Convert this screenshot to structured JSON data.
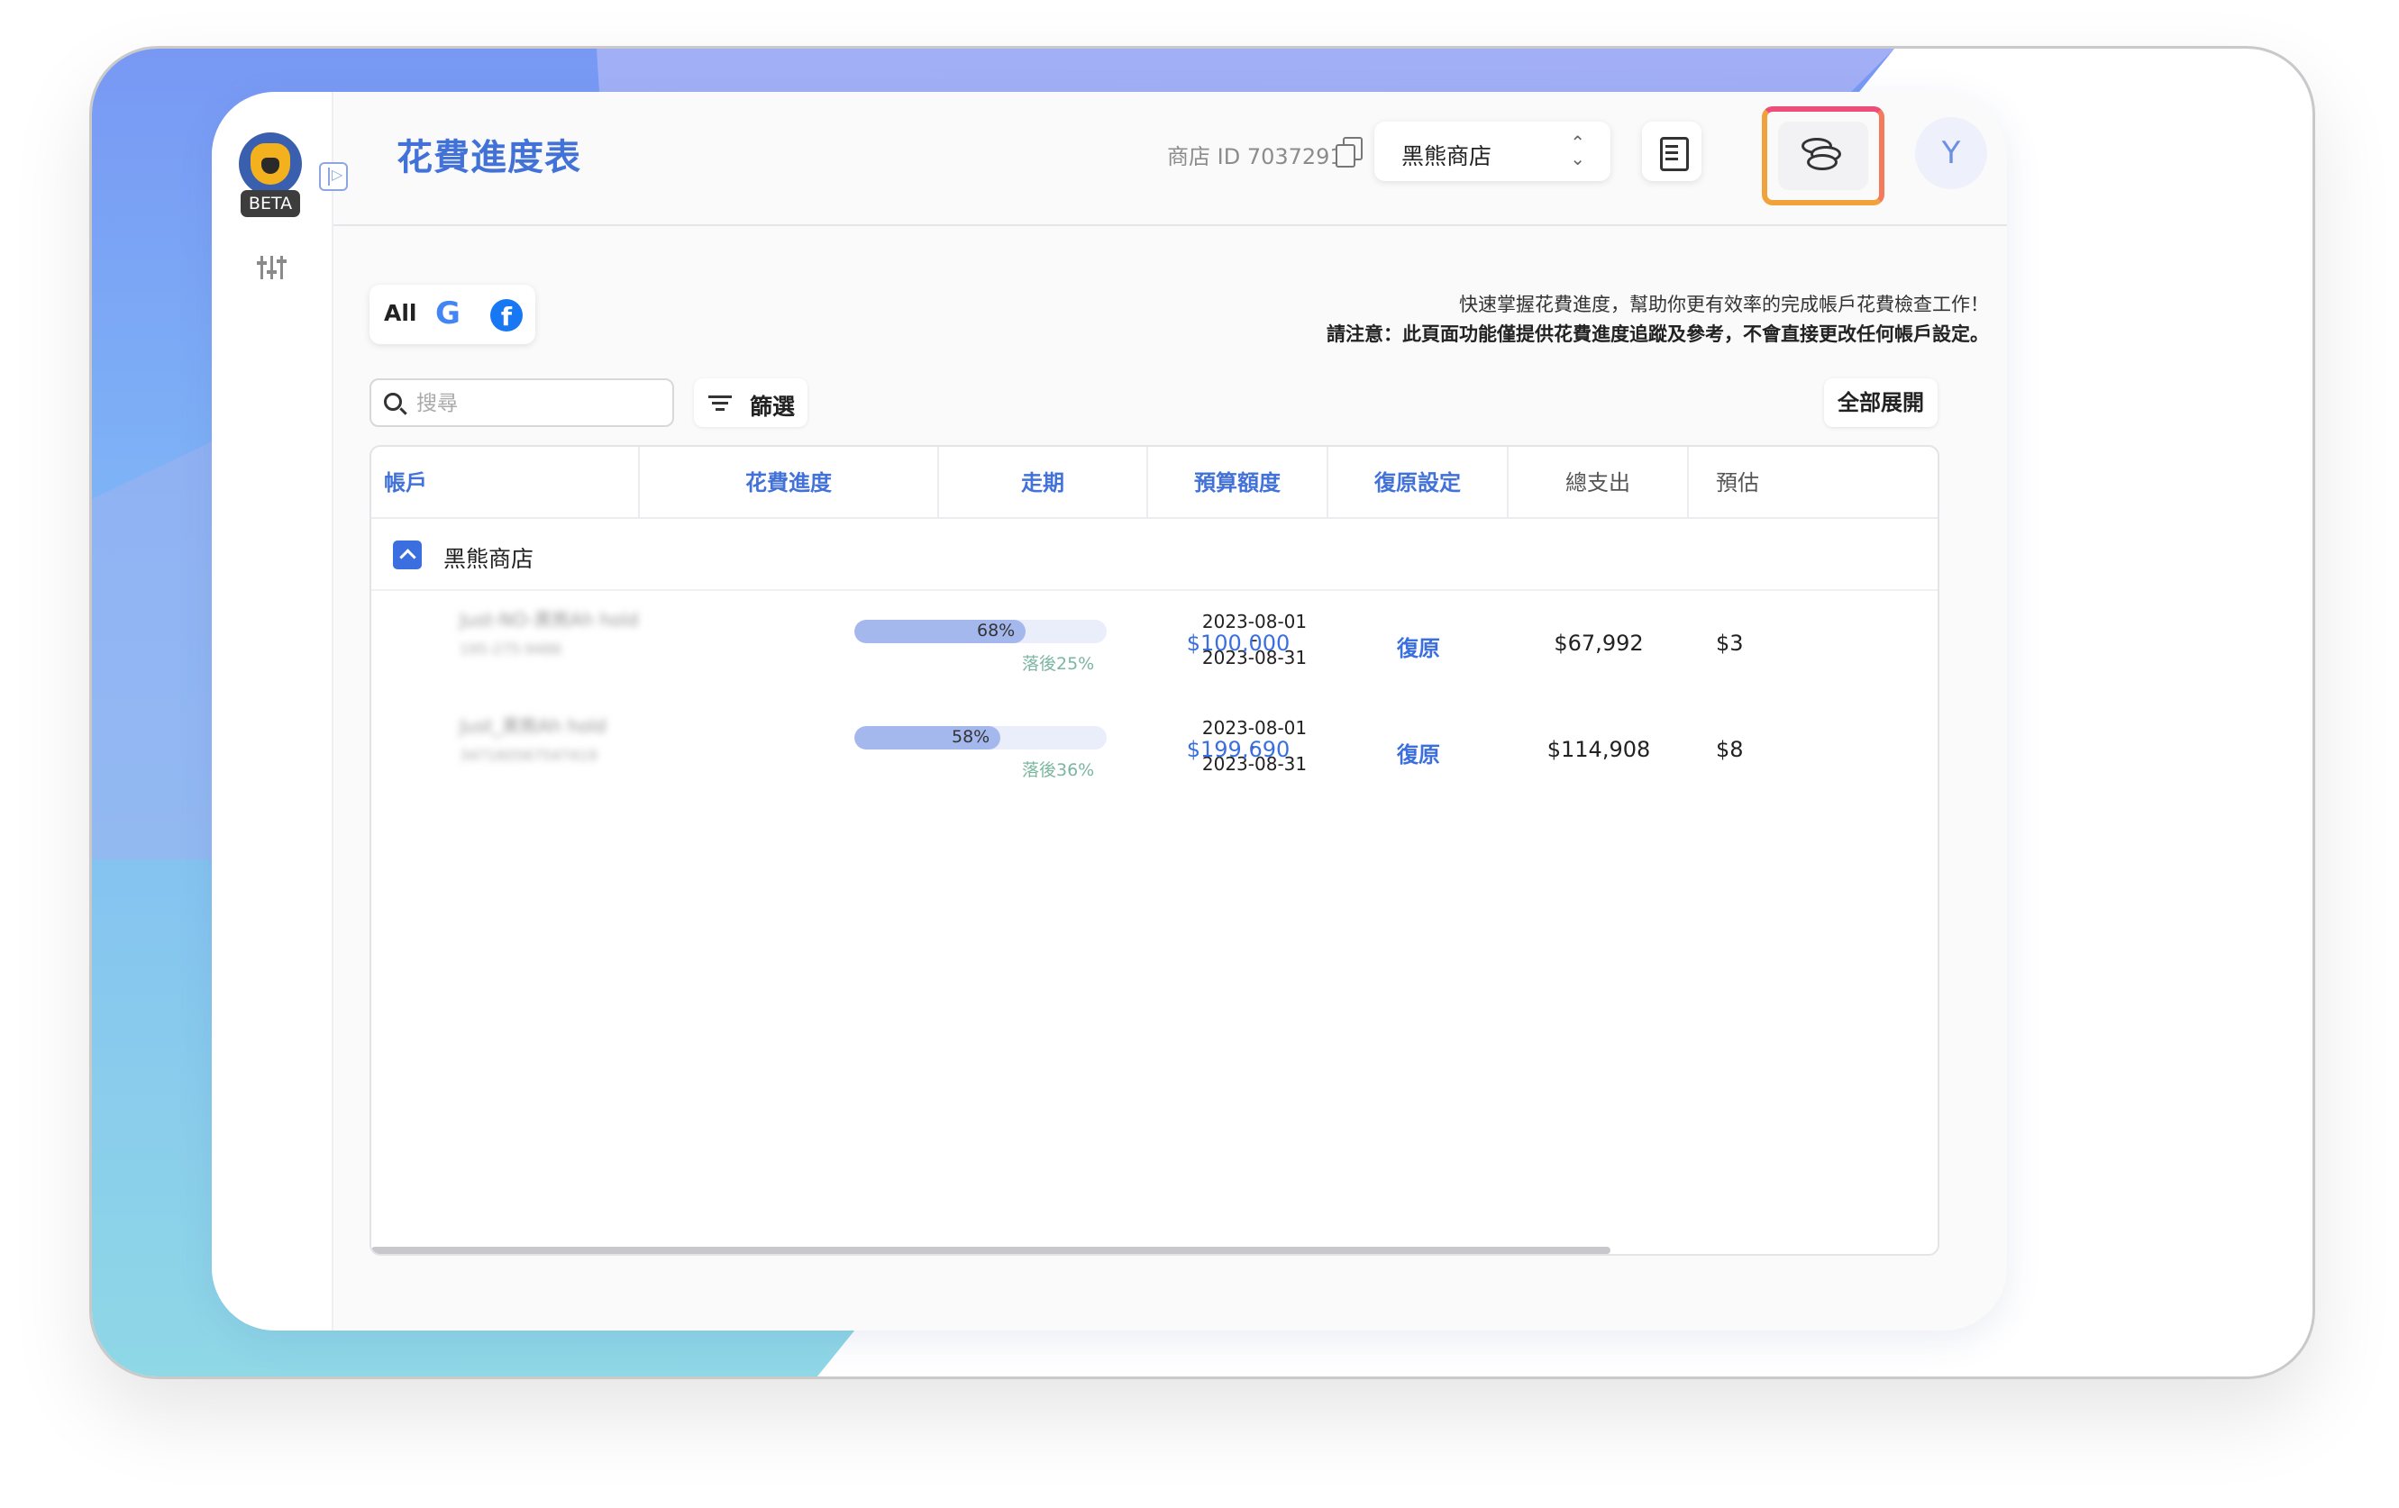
{
  "app": {
    "title": "花費進度表",
    "beta_badge": "BETA",
    "store_id_label": "商店 ID 70372918",
    "store_select": "黑熊商店",
    "avatar_initial": "Y"
  },
  "platforms": {
    "all_label": "All",
    "google_label": "G",
    "facebook_label": "f"
  },
  "info": {
    "line1": "快速掌握花費進度，幫助你更有效率的完成帳戶花費檢查工作！",
    "line2": "請注意：此頁面功能僅提供花費進度追蹤及參考，不會直接更改任何帳戶設定。"
  },
  "toolbar": {
    "search_placeholder": "搜尋",
    "filter_label": "篩選",
    "expand_all_label": "全部展開"
  },
  "table": {
    "headers": [
      "帳戶",
      "花費進度",
      "走期",
      "預算額度",
      "復原設定",
      "總支出",
      "預估"
    ],
    "group_name": "黑熊商店",
    "rows": [
      {
        "account_name": "Just-NO-黑熊Ah hold",
        "account_id": "195-275-9486",
        "progress": 0.68,
        "progress_label": "68%",
        "behind_label": "落後25%",
        "period_start": "2023-08-01",
        "period_sep": "-",
        "period_end": "2023-08-31",
        "budget": "$100,000",
        "restore": "復原",
        "total_spend": "$67,992",
        "estimate": "$3"
      },
      {
        "account_name": "Just_黑熊Ah hold",
        "account_id": "347160567547419",
        "progress": 0.58,
        "progress_label": "58%",
        "behind_label": "落後36%",
        "period_start": "2023-08-01",
        "period_sep": "-",
        "period_end": "2023-08-31",
        "budget": "$199,690",
        "restore": "復原",
        "total_spend": "$114,908",
        "estimate": "$8"
      }
    ]
  },
  "colors": {
    "accent": "#4272d8",
    "highlight_border": "#f2a23a",
    "progress_fill": "#a5b8ee",
    "behind_text": "#7bb6a0"
  }
}
